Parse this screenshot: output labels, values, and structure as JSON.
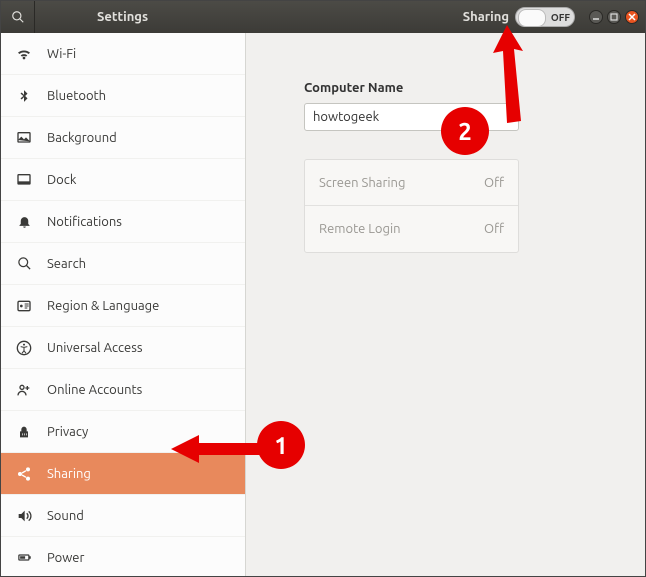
{
  "titlebar": {
    "title": "Settings",
    "section": "Sharing",
    "toggle_state": "OFF"
  },
  "sidebar": {
    "items": [
      {
        "label": "Wi-Fi",
        "icon": "wifi-icon"
      },
      {
        "label": "Bluetooth",
        "icon": "bluetooth-icon"
      },
      {
        "label": "Background",
        "icon": "background-icon"
      },
      {
        "label": "Dock",
        "icon": "dock-icon"
      },
      {
        "label": "Notifications",
        "icon": "notifications-icon"
      },
      {
        "label": "Search",
        "icon": "search-icon"
      },
      {
        "label": "Region & Language",
        "icon": "region-language-icon"
      },
      {
        "label": "Universal Access",
        "icon": "universal-access-icon"
      },
      {
        "label": "Online Accounts",
        "icon": "online-accounts-icon"
      },
      {
        "label": "Privacy",
        "icon": "privacy-icon"
      },
      {
        "label": "Sharing",
        "icon": "sharing-icon",
        "selected": true
      },
      {
        "label": "Sound",
        "icon": "sound-icon"
      },
      {
        "label": "Power",
        "icon": "power-icon"
      }
    ]
  },
  "main": {
    "computer_name_label": "Computer Name",
    "computer_name_value": "howtogeek",
    "rows": [
      {
        "label": "Screen Sharing",
        "state": "Off"
      },
      {
        "label": "Remote Login",
        "state": "Off"
      }
    ]
  },
  "annotations": {
    "one": "1",
    "two": "2"
  }
}
